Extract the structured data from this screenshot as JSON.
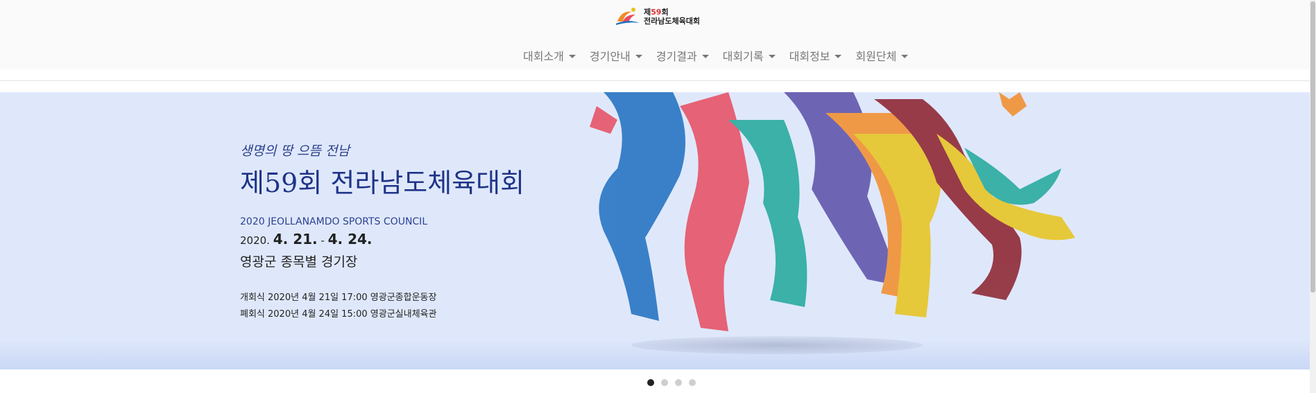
{
  "logo": {
    "line1_prefix": "제",
    "line1_num": "59",
    "line1_suffix": "회",
    "line2": "전라남도체육대회"
  },
  "nav": {
    "items": [
      {
        "label": "대회소개"
      },
      {
        "label": "경기안내"
      },
      {
        "label": "경기결과"
      },
      {
        "label": "대회기록"
      },
      {
        "label": "대회정보"
      },
      {
        "label": "회원단체"
      }
    ]
  },
  "banner": {
    "tagline": "생명의 땅 으뜸 전남",
    "headline": "제59회 전라남도체육대회",
    "council": "2020 JEOLLANAMDO SPORTS COUNCIL",
    "date_year": "2020.",
    "date_start": "4. 21.",
    "date_sep": "-",
    "date_end": "4. 24.",
    "venue": "영광군 종목별 경기장",
    "opening": "개회식 2020년 4월 21일 17:00 영광군종합운동장",
    "closing": "폐회식 2020년 4월 24일 15:00 영광군실내체육관",
    "background_color": "#dfe8fb",
    "runner_colors": [
      "#1e6fc0",
      "#e84b5f",
      "#1fa89a",
      "#f28c28",
      "#e8c31a",
      "#8b1e2a",
      "#5a4fa8"
    ]
  },
  "carousel": {
    "slide_count": 4,
    "active_index": 0
  }
}
